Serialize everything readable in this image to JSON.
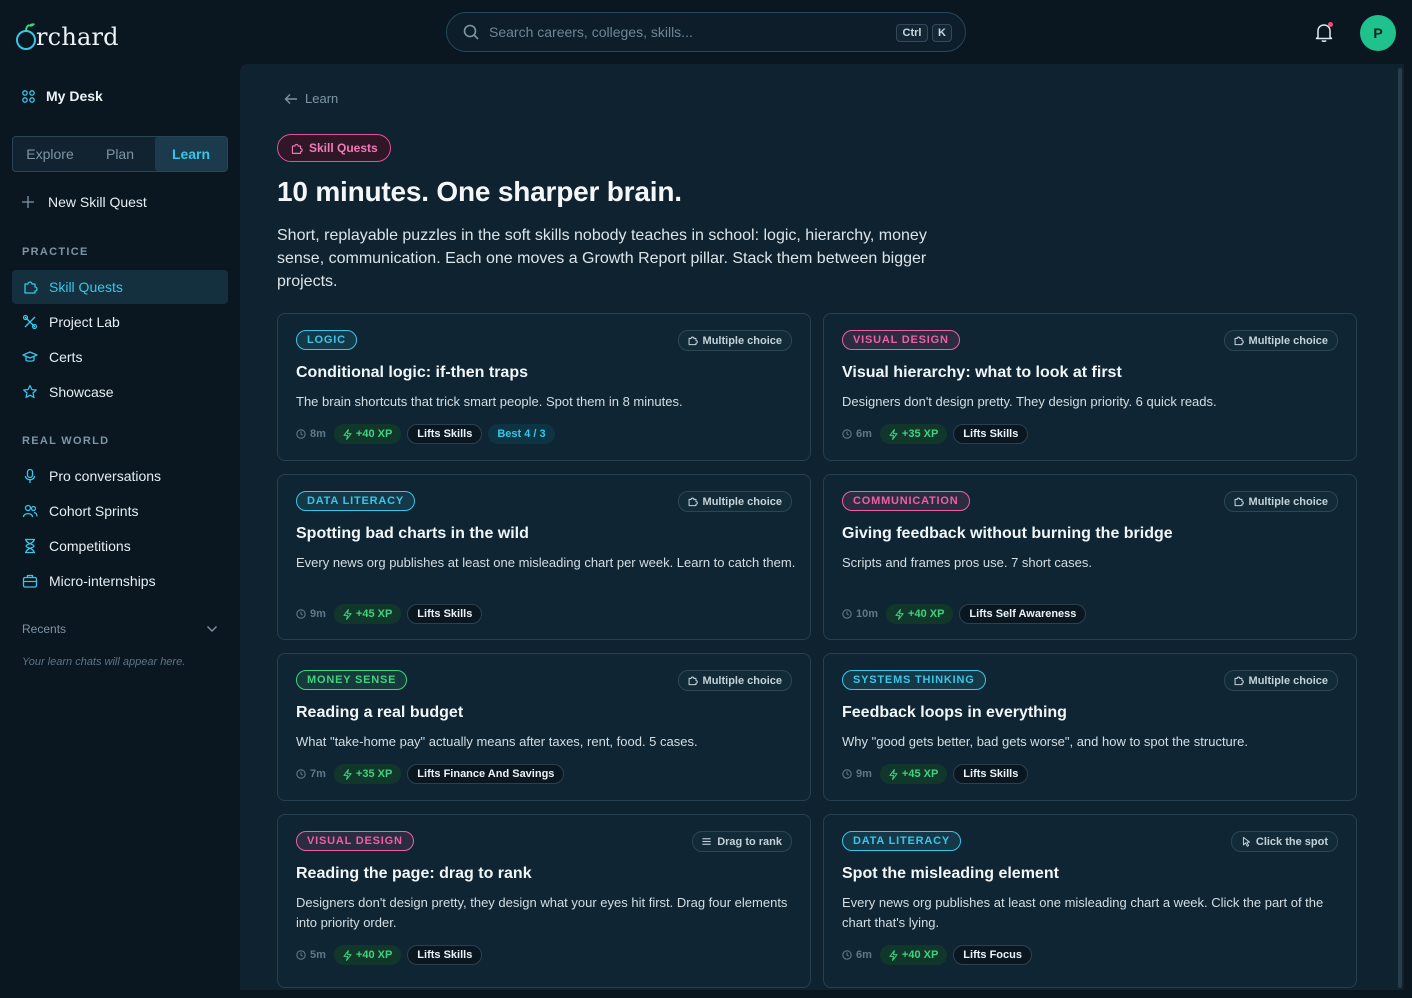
{
  "app": {
    "logo_text": "rchard"
  },
  "search": {
    "placeholder": "Search careers, colleges, skills...",
    "kbd_ctrl": "Ctrl",
    "kbd_k": "K"
  },
  "user": {
    "avatar_initial": "P"
  },
  "sidebar": {
    "my_desk": "My Desk",
    "tabs": [
      {
        "label": "Explore"
      },
      {
        "label": "Plan"
      },
      {
        "label": "Learn"
      }
    ],
    "active_tab": "Learn",
    "new_quest": "New Skill Quest",
    "practice_label": "PRACTICE",
    "practice_items": [
      {
        "label": "Skill Quests",
        "icon": "puzzle-icon"
      },
      {
        "label": "Project Lab",
        "icon": "tools-icon"
      },
      {
        "label": "Certs",
        "icon": "graduation-cap-icon"
      },
      {
        "label": "Showcase",
        "icon": "star-icon"
      }
    ],
    "realworld_label": "REAL WORLD",
    "realworld_items": [
      {
        "label": "Pro conversations",
        "icon": "microphone-icon"
      },
      {
        "label": "Cohort Sprints",
        "icon": "users-icon"
      },
      {
        "label": "Competitions",
        "icon": "hourglass-icon"
      },
      {
        "label": "Micro-internships",
        "icon": "briefcase-icon"
      }
    ],
    "recents_label": "Recents",
    "recents_empty": "Your learn chats will appear here."
  },
  "main": {
    "breadcrumb": "Learn",
    "pill": "Skill Quests",
    "headline": "10 minutes. One sharper brain.",
    "intro": "Short, replayable puzzles in the soft skills nobody teaches in school: logic, hierarchy, money sense, communication. Each one moves a Growth Report pillar. Stack them between bigger projects.",
    "cards": [
      {
        "category": "LOGIC",
        "category_color": "#38c6e8",
        "format": "Multiple choice",
        "format_icon": "puzzle-icon",
        "title": "Conditional logic: if-then traps",
        "desc": "The brain shortcuts that trick smart people. Spot them in 8 minutes.",
        "time": "8m",
        "xp": "+40 XP",
        "lifts": "Lifts Skills",
        "best": "Best 4 / 3"
      },
      {
        "category": "VISUAL DESIGN",
        "category_color": "#ef5fa6",
        "format": "Multiple choice",
        "format_icon": "puzzle-icon",
        "title": "Visual hierarchy: what to look at first",
        "desc": "Designers don't design pretty. They design priority. 6 quick reads.",
        "time": "6m",
        "xp": "+35 XP",
        "lifts": "Lifts Skills"
      },
      {
        "category": "DATA LITERACY",
        "category_color": "#38c6e8",
        "format": "Multiple choice",
        "format_icon": "puzzle-icon",
        "title": "Spotting bad charts in the wild",
        "desc": "Every news org publishes at least one misleading chart per week. Learn to catch them.",
        "time": "9m",
        "xp": "+45 XP",
        "lifts": "Lifts Skills"
      },
      {
        "category": "COMMUNICATION",
        "category_color": "#ef5fa6",
        "format": "Multiple choice",
        "format_icon": "puzzle-icon",
        "title": "Giving feedback without burning the bridge",
        "desc": "Scripts and frames pros use. 7 short cases.",
        "time": "10m",
        "xp": "+40 XP",
        "lifts": "Lifts Self Awareness"
      },
      {
        "category": "MONEY SENSE",
        "category_color": "#3fd27f",
        "format": "Multiple choice",
        "format_icon": "puzzle-icon",
        "title": "Reading a real budget",
        "desc": "What \"take-home pay\" actually means after taxes, rent, food. 5 cases.",
        "time": "7m",
        "xp": "+35 XP",
        "lifts": "Lifts Finance And Savings"
      },
      {
        "category": "SYSTEMS THINKING",
        "category_color": "#38c6e8",
        "format": "Multiple choice",
        "format_icon": "puzzle-icon",
        "title": "Feedback loops in everything",
        "desc": "Why \"good gets better, bad gets worse\", and how to spot the structure.",
        "time": "9m",
        "xp": "+45 XP",
        "lifts": "Lifts Skills"
      },
      {
        "category": "VISUAL DESIGN",
        "category_color": "#ef5fa6",
        "format": "Drag to rank",
        "format_icon": "drag-lines-icon",
        "title": "Reading the page: drag to rank",
        "desc": "Designers don't design pretty, they design what your eyes hit first. Drag four elements into priority order.",
        "time": "5m",
        "xp": "+40 XP",
        "lifts": "Lifts Skills"
      },
      {
        "category": "DATA LITERACY",
        "category_color": "#38c6e8",
        "format": "Click the spot",
        "format_icon": "pointer-icon",
        "title": "Spot the misleading element",
        "desc": "Every news org publishes at least one misleading chart a week. Click the part of the chart that's lying.",
        "time": "6m",
        "xp": "+40 XP",
        "lifts": "Lifts Focus"
      }
    ]
  },
  "colors": {
    "accent": "#38c6e8",
    "pink": "#ef5fa6",
    "green": "#3fd27f",
    "background": "#0a1620",
    "panel": "#0f2230"
  }
}
